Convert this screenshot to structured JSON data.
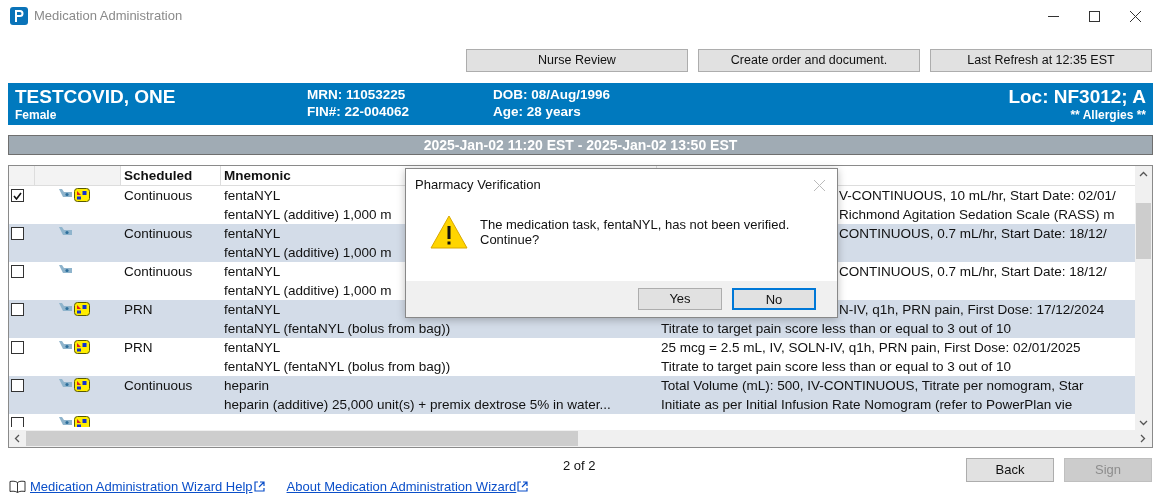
{
  "window": {
    "title": "Medication Administration"
  },
  "toolbar_buttons": [
    "Nurse Review",
    "Create order and document.",
    "Last Refresh at 12:35 EST"
  ],
  "patient": {
    "name": "TESTCOVID, ONE",
    "sex": "Female",
    "mrn": "MRN: 11053225",
    "fin": "FIN#: 22-004062",
    "dob": "DOB: 08/Aug/1996",
    "age": "Age: 28 years",
    "location": "Loc: NF3012; A",
    "allergies": "** Allergies **"
  },
  "time_range": "2025-Jan-02 11:20 EST - 2025-Jan-02 13:50 EST",
  "table": {
    "columns": [
      "Scheduled",
      "Mnemonic"
    ],
    "rows": [
      {
        "checked": true,
        "alert_icon": true,
        "scheduled": "Continuous",
        "mnemonic": [
          "fentaNYL",
          "fentaNYL (additive) 1,000 m"
        ],
        "details": [
          {
            "text": "V-CONTINUOUS, 10 mL/hr, Start Date: 02/01/",
            "covered": true
          },
          {
            "text": "Richmond Agitation Sedation Scale (RASS) m",
            "covered": true
          }
        ]
      },
      {
        "checked": false,
        "alert_icon": false,
        "scheduled": "Continuous",
        "mnemonic": [
          "fentaNYL",
          "fentaNYL (additive) 1,000 m"
        ],
        "details": [
          {
            "text": "CONTINUOUS, 0.7 mL/hr, Start Date: 18/12/",
            "covered": true
          }
        ]
      },
      {
        "checked": false,
        "alert_icon": false,
        "scheduled": "Continuous",
        "mnemonic": [
          "fentaNYL",
          "fentaNYL (additive) 1,000 m"
        ],
        "details": [
          {
            "text": "CONTINUOUS, 0.7 mL/hr, Start Date: 18/12/",
            "covered": true
          }
        ]
      },
      {
        "checked": false,
        "alert_icon": true,
        "scheduled": "PRN",
        "mnemonic": [
          "fentaNYL",
          "fentaNYL (fentaNYL (bolus from bag))"
        ],
        "details": [
          {
            "text": "N-IV, q1h, PRN pain, First Dose: 17/12/2024",
            "covered": true
          },
          {
            "text": "Titrate to target pain score less than or equal to 3 out of 10",
            "covered": false
          }
        ]
      },
      {
        "checked": false,
        "alert_icon": true,
        "scheduled": "PRN",
        "mnemonic": [
          "fentaNYL",
          "fentaNYL (fentaNYL (bolus from bag))"
        ],
        "details": [
          {
            "text": "25 mcg = 2.5 mL, IV, SOLN-IV, q1h, PRN pain, First Dose: 02/01/2025",
            "covered": false
          },
          {
            "text": "Titrate to target pain score less than or equal to 3 out of 10",
            "covered": false
          }
        ]
      },
      {
        "checked": false,
        "alert_icon": true,
        "scheduled": "Continuous",
        "mnemonic": [
          "heparin",
          "heparin (additive) 25,000 unit(s) + premix dextrose 5% in water..."
        ],
        "details": [
          {
            "text": "Total Volume (mL): 500, IV-CONTINUOUS, Titrate per nomogram, Star",
            "covered": false
          },
          {
            "text": "Initiate as per Initial Infusion Rate Nomogram (refer to PowerPlan vie",
            "covered": false
          }
        ]
      },
      {
        "checked": false,
        "alert_icon": true
      }
    ]
  },
  "dialog": {
    "title": "Pharmacy Verification",
    "message": [
      "The medication task, fentaNYL, has not been verified.",
      "Continue?"
    ],
    "buttons": [
      {
        "label": "Yes",
        "focused": false
      },
      {
        "label": "No",
        "focused": true
      }
    ]
  },
  "footer": {
    "page": "2 of 2",
    "buttons": [
      {
        "label": "Back",
        "disabled": false
      },
      {
        "label": "Sign",
        "disabled": true
      }
    ],
    "links": [
      "Medication Administration Wizard Help",
      "About Medication Administration Wizard"
    ]
  }
}
